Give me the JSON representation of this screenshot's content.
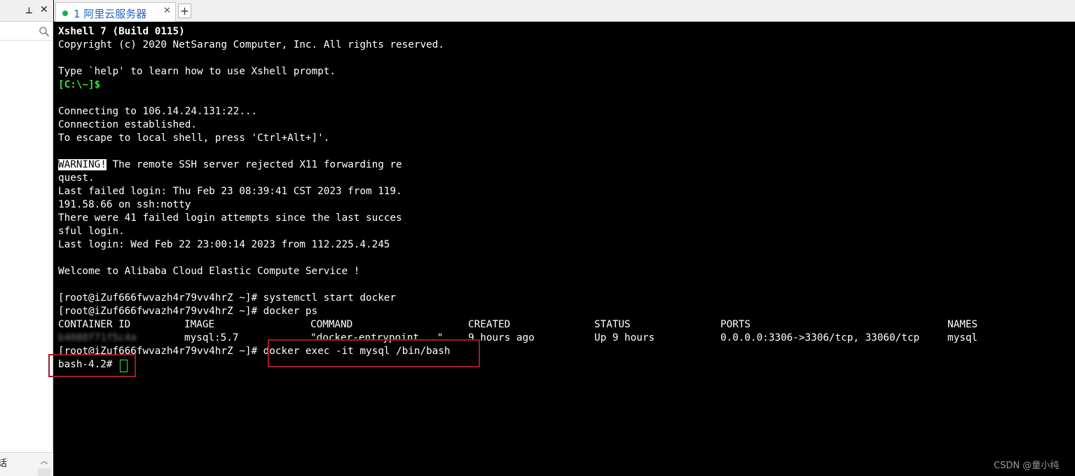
{
  "sidebar": {
    "pin_icon": "pin-icon",
    "close_icon": "close-icon",
    "search_icon": "search-icon",
    "bottom_text": "话",
    "scroll_up_icon": "chevron-up-icon"
  },
  "tabs": [
    {
      "label": "1 阿里云服务器",
      "status_color": "#16b04a",
      "active": true
    }
  ],
  "new_tab_label": "+",
  "terminal": {
    "lines": [
      "Xshell 7 (Build 0115)",
      "Copyright (c) 2020 NetSarang Computer, Inc. All rights reserved.",
      "",
      "Type `help' to learn how to use Xshell prompt.",
      "[C:\\~]$",
      "",
      "Connecting to 106.14.24.131:22...",
      "Connection established.",
      "To escape to local shell, press 'Ctrl+Alt+]'.",
      "",
      "WARNING!",
      " The remote SSH server rejected X11 forwarding re",
      "quest.",
      "Last failed login: Thu Feb 23 08:39:41 CST 2023 from 119.",
      "191.58.66 on ssh:notty",
      "There were 41 failed login attempts since the last succes",
      "sful login.",
      "Last login: Wed Feb 22 23:00:14 2023 from 112.225.4.245",
      "",
      "Welcome to Alibaba Cloud Elastic Compute Service !",
      "",
      "[root@iZuf666fwvazh4r79vv4hrZ ~]# systemctl start docker",
      "[root@iZuf666fwvazh4r79vv4hrZ ~]# docker ps",
      "[root@iZuf666fwvazh4r79vv4hrZ ~]#",
      " docker exec -it mysql /bin/bash",
      "bash-4.2#"
    ],
    "docker_ps": {
      "headers": [
        "CONTAINER ID",
        "IMAGE",
        "COMMAND",
        "CREATED",
        "STATUS",
        "PORTS",
        "NAMES"
      ],
      "row": [
        "b4088f71f5c4a",
        "mysql:5.7",
        "\"docker-entrypoint...\"",
        "9 hours ago",
        "Up 9 hours",
        "0.0.0.0:3306->3306/tcp, 33060/tcp",
        "mysql"
      ]
    },
    "prompt_color": "#3fe13f",
    "highlight_color": "#a01a28"
  },
  "watermark": "CSDN @童小纯"
}
